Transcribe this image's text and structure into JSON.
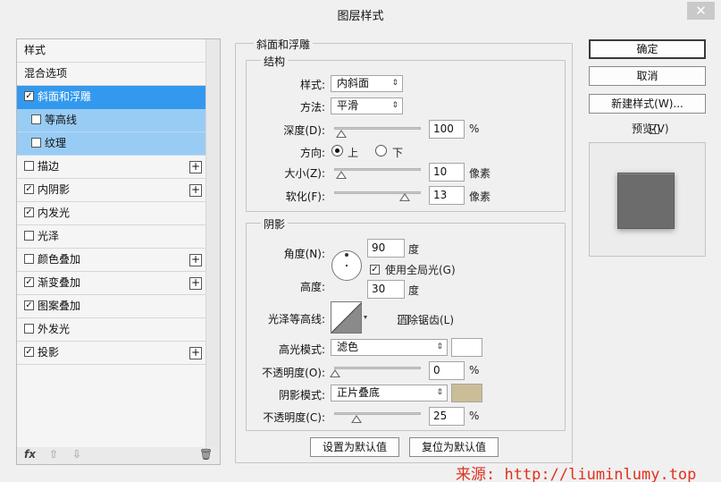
{
  "window": {
    "title": "图层样式",
    "close_glyph": "✕"
  },
  "layers": {
    "header": "样式",
    "blend": "混合选项",
    "items": [
      {
        "label": "斜面和浮雕",
        "checked": "☑",
        "mark": "✓"
      },
      {
        "label": "等高线",
        "mark": ""
      },
      {
        "label": "纹理",
        "mark": ""
      },
      {
        "label": "描边",
        "mark": "",
        "plus": "+"
      },
      {
        "label": "内阴影",
        "mark": "✓",
        "plus": "+"
      },
      {
        "label": "内发光",
        "mark": "✓"
      },
      {
        "label": "光泽",
        "mark": ""
      },
      {
        "label": "颜色叠加",
        "mark": "",
        "plus": "+"
      },
      {
        "label": "渐变叠加",
        "mark": "✓",
        "plus": "+"
      },
      {
        "label": "图案叠加",
        "mark": "✓"
      },
      {
        "label": "外发光",
        "mark": ""
      },
      {
        "label": "投影",
        "mark": "✓",
        "plus": "+"
      }
    ],
    "footer": {
      "fx": "fx",
      "up": "⇧",
      "down": "⇩",
      "trash": "🗑"
    }
  },
  "bevel": {
    "group_title": "斜面和浮雕",
    "structure_title": "结构",
    "style_label": "样式:",
    "style_value": "内斜面",
    "method_label": "方法:",
    "method_value": "平滑",
    "depth_label": "深度(D):",
    "depth_value": "100",
    "depth_unit": "%",
    "direction_label": "方向:",
    "dir_up": "上",
    "dir_down": "下",
    "size_label": "大小(Z):",
    "size_value": "10",
    "size_unit": "像素",
    "soften_label": "软化(F):",
    "soften_value": "13",
    "soften_unit": "像素"
  },
  "shading": {
    "title": "阴影",
    "angle_label": "角度(N):",
    "angle_value": "90",
    "angle_unit": "度",
    "global_light": "使用全局光(G)",
    "altitude_label": "高度:",
    "altitude_value": "30",
    "altitude_unit": "度",
    "gloss_label": "光泽等高线:",
    "antialias": "消除锯齿(L)",
    "highlight_label": "高光模式:",
    "highlight_value": "滤色",
    "highlight_color": "#ffffff",
    "hl_opacity_label": "不透明度(O):",
    "hl_opacity_value": "0",
    "hl_opacity_unit": "%",
    "shadow_label": "阴影模式:",
    "shadow_value": "正片叠底",
    "shadow_color": "#cbbd98",
    "sh_opacity_label": "不透明度(C):",
    "sh_opacity_value": "25",
    "sh_opacity_unit": "%",
    "make_default": "设置为默认值",
    "reset_default": "复位为默认值"
  },
  "side": {
    "ok": "确定",
    "cancel": "取消",
    "new_style": "新建样式(W)...",
    "preview": "预览(V)"
  },
  "watermark": "来源: http://liuminlumy.top"
}
